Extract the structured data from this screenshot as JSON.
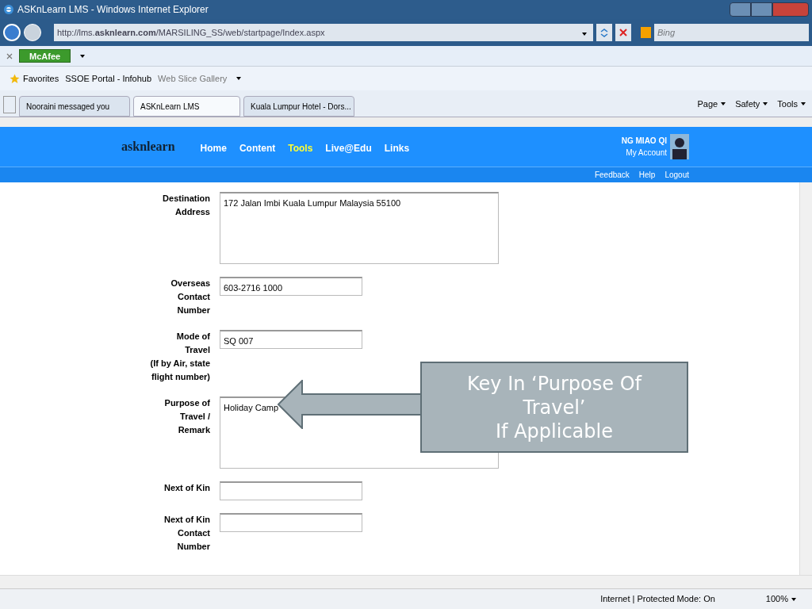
{
  "window": {
    "title": "ASKnLearn LMS - Windows Internet Explorer"
  },
  "address": {
    "url": "http://lms.**asknlearn.com**/MARSILING_SS/web/startpage/Index.aspx"
  },
  "search": {
    "placeholder": "Bing"
  },
  "mcafee": {
    "label": "McAfee"
  },
  "favorites": {
    "label": "Favorites",
    "links": [
      "SSOE Portal - Infohub",
      "Web Slice Gallery"
    ]
  },
  "tabs": [
    {
      "label": "Nooraini messaged you",
      "selected": false
    },
    {
      "label": "ASKnLearn LMS",
      "selected": true
    },
    {
      "label": "Kuala Lumpur Hotel - Dors...",
      "selected": false
    }
  ],
  "commands": [
    "Page",
    "Safety",
    "Tools"
  ],
  "site": {
    "logo": "asknlearn",
    "nav": [
      {
        "label": "Home",
        "selected": false
      },
      {
        "label": "Content",
        "selected": false
      },
      {
        "label": "Tools",
        "selected": true
      },
      {
        "label": "Live@Edu",
        "selected": false
      },
      {
        "label": "Links",
        "selected": false
      }
    ],
    "user": "NG MIAO QI",
    "account": "My Account",
    "links": [
      "Feedback",
      "Help",
      "Logout"
    ]
  },
  "form": [
    {
      "label": [
        "Destination",
        "Address"
      ],
      "kind": "textarea",
      "value": "172 Jalan Imbi Kuala Lumpur Malaysia 55100"
    },
    {
      "label": [
        "Overseas",
        "Contact",
        "Number"
      ],
      "kind": "input",
      "value": "603-2716 1000"
    },
    {
      "label": [
        "Mode of",
        "Travel",
        "(If by Air, state",
        "flight number)"
      ],
      "kind": "input",
      "value": "SQ 007"
    },
    {
      "label": [
        "Purpose of",
        "Travel /",
        "Remark"
      ],
      "kind": "textarea",
      "value": "Holiday Camp"
    },
    {
      "label": [
        "Next of Kin"
      ],
      "kind": "input"
    },
    {
      "label": [
        "Next of Kin",
        "Contact",
        "Number"
      ],
      "kind": "input"
    }
  ],
  "callout": {
    "lines": [
      "Key In ‘Purpose Of Travel’",
      "If Applicable"
    ]
  },
  "status": {
    "text": "Internet | Protected Mode: On",
    "zoom": "100%"
  }
}
